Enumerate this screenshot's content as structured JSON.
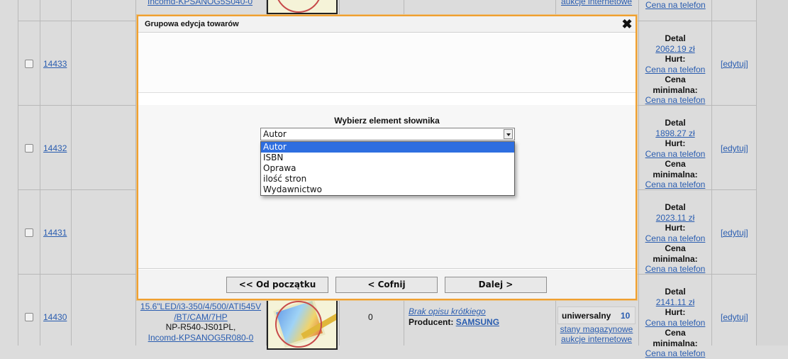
{
  "rows": [
    {
      "id": "14433",
      "price_detal": "2062.19 zł",
      "edit": "[edytuj]"
    },
    {
      "id": "14432",
      "price_detal": "1898.27 zł",
      "edit": "[edytuj]"
    },
    {
      "id": "14431",
      "price_detal": "2023.11 zł",
      "edit": "[edytuj]"
    },
    {
      "id": "14430",
      "price_detal": "2141.11 zł",
      "edit": "[edytuj]",
      "product_lines": [
        "15.6\"LED/i3-350/4/500/ATI545V",
        "/BT/CAM/7HP",
        "NP-R540-JS01PL,",
        "Incomd-KPSANOG5R080-0"
      ],
      "stock": "0",
      "desc_missing": "Brak opisu krótkiego",
      "producer_label": "Producent:",
      "producer": "SAMSUNG",
      "warehouse": "uniwersalny",
      "warehouse_qty": "10",
      "link_stock": "stany magazynowe",
      "link_auctions": "aukcje internetowe"
    }
  ],
  "top_partial": {
    "product_code": "Incomd-KPSANOG5S040-0",
    "link_auctions": "aukcje internetowe",
    "price_link": "Cena na telefon"
  },
  "price_labels": {
    "detal": "Detal",
    "hurt": "Hurt:",
    "hurt_value": "Cena na telefon",
    "min": "Cena minimalna:",
    "min_value": "Cena na telefon"
  },
  "modal": {
    "title": "Grupowa edycja towarów",
    "close_glyph": "✖",
    "select_label": "Wybierz element słownika",
    "selected": "Autor",
    "options": [
      "Autor",
      "ISBN",
      "Oprawa",
      "ilość stron",
      "Wydawnictwo"
    ],
    "buttons": {
      "start": "<< Od początku",
      "back": "< Cofnij",
      "next": "Dalej >"
    }
  },
  "colors": {
    "modal_border": "#f0a030",
    "selected_option": "#2e6ee0",
    "link": "#2a5db0"
  }
}
